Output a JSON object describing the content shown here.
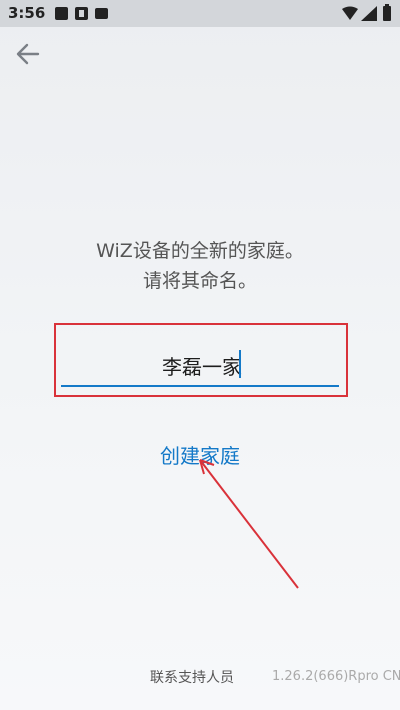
{
  "status_bar": {
    "time": "3:56",
    "icons": [
      "image-icon",
      "a-icon",
      "message-icon",
      "wifi-icon",
      "signal-icon",
      "battery-icon"
    ]
  },
  "header": {
    "back_icon": "back-arrow-icon"
  },
  "main": {
    "heading_line1": "WiZ设备的全新的家庭。",
    "heading_line2": "请将其命名。",
    "home_name_value": "李磊一家",
    "create_home_label": "创建家庭"
  },
  "footer": {
    "support_label": "联系支持人员",
    "version": "1.26.2(666)Rpro CN"
  },
  "colors": {
    "accent": "#1479c8",
    "annotation": "#d9323a",
    "text": "#555555"
  }
}
